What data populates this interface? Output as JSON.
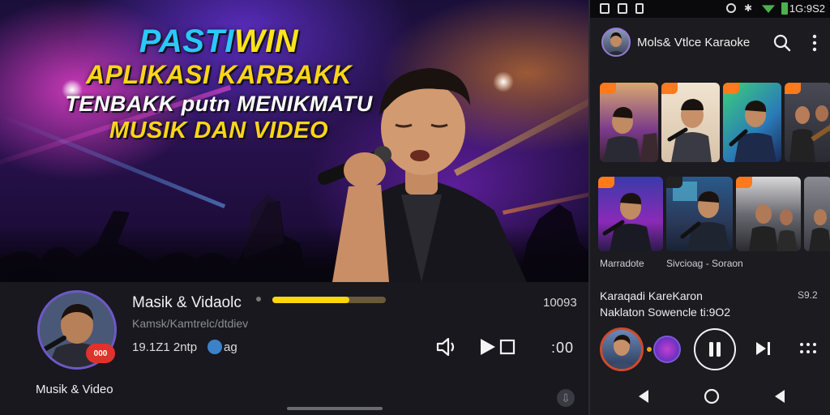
{
  "hero": {
    "title_line1_blue": "PASTI",
    "title_line1_yellow": "WIN",
    "title_line2": "APLIKASI KARBAKK",
    "title_line3": "TENBAKK putn MENIKMATU",
    "title_line4": "MUSIK DAN VIDEO"
  },
  "player": {
    "track_title": "Masik & Vidaolc",
    "track_subtitle": "Kamsk/Kamtrelc/dtdiev",
    "meta_left": "19.1Z1 2ntp",
    "meta_right": "ag",
    "time": "10093",
    "progress_fraction": 0.68,
    "avatar_badge": "000",
    "avatar_caption": "Musik & Video",
    "more_label": ":00"
  },
  "phone": {
    "status": {
      "time": "1G:9S2"
    },
    "app_title": "Mols& Vtlce Karaoke",
    "row2_captions": [
      "Marradote",
      "Sivcioag - Soraon"
    ],
    "now_playing": {
      "line1": "Karaqadi KareKaron",
      "line2": "Naklaton Sowencle ti:9O2",
      "right_value": "S9.2"
    }
  },
  "colors": {
    "accent_yellow": "#ffd60a",
    "title_blue": "#29c8ff",
    "badge_red": "#e0322c",
    "avatar_ring": "#6e58c8"
  },
  "icons": [
    "volume-icon",
    "play-icon",
    "stop-icon",
    "search-icon",
    "more-vert-icon",
    "pause-icon",
    "skip-next-icon",
    "grid-icon",
    "back-icon",
    "home-icon",
    "recents-icon",
    "download-icon"
  ]
}
